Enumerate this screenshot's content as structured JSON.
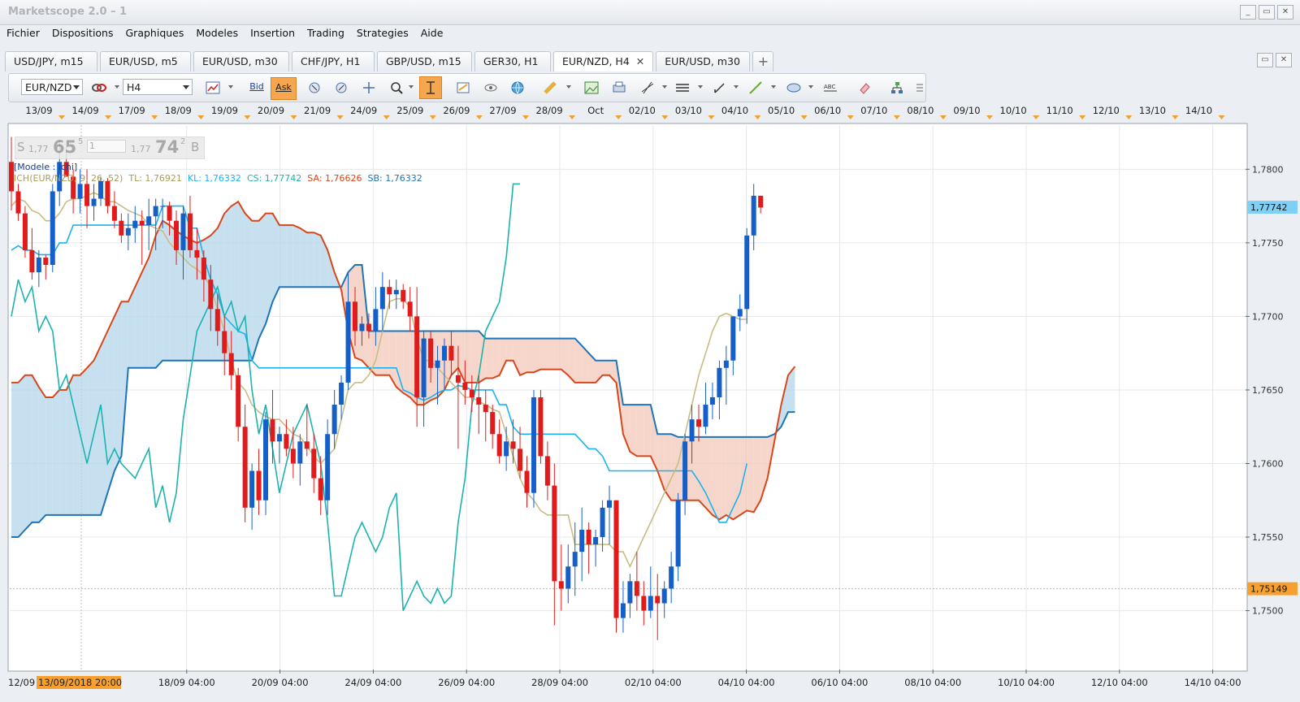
{
  "window": {
    "title": "Marketscope 2.0 – 1",
    "buttons": [
      "_",
      "▭",
      "✕"
    ]
  },
  "menu": [
    "Fichier",
    "Dispositions",
    "Graphiques",
    "Modeles",
    "Insertion",
    "Trading",
    "Strategies",
    "Aide"
  ],
  "tabs": [
    {
      "label": "USD/JPY, m15"
    },
    {
      "label": "EUR/USD, m5"
    },
    {
      "label": "EUR/USD, m30"
    },
    {
      "label": "CHF/JPY, H1"
    },
    {
      "label": "GBP/USD, m15"
    },
    {
      "label": "GER30, H1"
    },
    {
      "label": "EUR/NZD, H4",
      "active": true
    },
    {
      "label": "EUR/USD, m30"
    }
  ],
  "toolbar": {
    "instrument": "EUR/NZD",
    "timeframe": "H4",
    "bid_label": "Bid",
    "ask_label": "Ask",
    "icons": [
      "instrument-link-icon",
      "chart-type-icon",
      "cursor-left-icon",
      "cursor-right-icon",
      "crosshair-icon",
      "zoom-icon",
      "tracking-icon",
      "template-icon",
      "eye-icon",
      "globe-icon",
      "ruler-icon",
      "image-icon",
      "print-icon",
      "line-tools-icon",
      "horizontal-lines-icon",
      "pen-icon",
      "trend-line-icon",
      "ellipse-icon",
      "text-icon",
      "eraser-icon",
      "hierarchy-icon",
      "menu-icon"
    ]
  },
  "quote": {
    "sell_label": "S",
    "sell_prefix": "1,77",
    "sell_big": "65",
    "sell_sup": "5",
    "amount": "1",
    "buy_prefix": "1,77",
    "buy_big": "74",
    "buy_sup": "2",
    "buy_label": "B"
  },
  "legend": {
    "model": "[Modele : ichi]",
    "ichimoku_name": "ICH(EUR/NZD, 9, 26, 52)",
    "tl": "TL: 1,76921",
    "kl": "KL: 1,76332",
    "cs": "CS: 1,77742",
    "sa": "SA: 1,76626",
    "sb": "SB: 1,76332"
  },
  "colors": {
    "bull": "#1460c8",
    "bear": "#e01b1b",
    "tenkan": "#c8bd84",
    "kijun": "#1ab3ef",
    "chikou": "#1bb3b0",
    "senkou_a": "#d8461a",
    "senkou_b": "#1e74b8",
    "cloud_bull": "#b4d6ea",
    "cloud_bear": "#f3c8b8"
  },
  "chart_data": {
    "type": "candlestick",
    "instrument": "EUR/NZD",
    "timeframe": "H4",
    "ylim": [
      1.746,
      1.783
    ],
    "y_ticks": [
      "1,7800",
      "1,7750",
      "1,7700",
      "1,7650",
      "1,7600",
      "1,7550",
      "1,7500"
    ],
    "top_dates": [
      "13/09",
      "14/09",
      "17/09",
      "18/09",
      "19/09",
      "20/09",
      "21/09",
      "24/09",
      "25/09",
      "26/09",
      "27/09",
      "28/09",
      "Oct",
      "02/10",
      "03/10",
      "04/10",
      "05/10",
      "06/10",
      "07/10",
      "08/10",
      "09/10",
      "10/10",
      "11/10",
      "12/10",
      "13/10",
      "14/10"
    ],
    "bottom_dates": [
      "12/09",
      "13/09/2018 20:00",
      "18/09 04:00",
      "20/09 04:00",
      "24/09 04:00",
      "26/09 04:00",
      "28/09 04:00",
      "02/10 04:00",
      "04/10 04:00",
      "06/10 04:00",
      "08/10 04:00",
      "10/10 04:00",
      "12/10 04:00",
      "14/10 04:00"
    ],
    "current_price": "1,77742",
    "crosshair_price": "1,75149",
    "candles": [
      [
        1.7805,
        1.7822,
        1.7772,
        1.7785
      ],
      [
        1.7785,
        1.779,
        1.7765,
        1.777
      ],
      [
        1.777,
        1.7775,
        1.774,
        1.7745
      ],
      [
        1.7745,
        1.776,
        1.7725,
        1.773
      ],
      [
        1.773,
        1.7745,
        1.772,
        1.774
      ],
      [
        1.774,
        1.7742,
        1.7725,
        1.7735
      ],
      [
        1.7735,
        1.779,
        1.773,
        1.7785
      ],
      [
        1.7785,
        1.782,
        1.7775,
        1.7805
      ],
      [
        1.7805,
        1.7815,
        1.7795,
        1.7795
      ],
      [
        1.7795,
        1.78,
        1.777,
        1.778
      ],
      [
        1.778,
        1.78,
        1.777,
        1.779
      ],
      [
        1.779,
        1.78,
        1.776,
        1.7775
      ],
      [
        1.7775,
        1.779,
        1.7765,
        1.778
      ],
      [
        1.778,
        1.7795,
        1.7775,
        1.7792
      ],
      [
        1.7792,
        1.7794,
        1.777,
        1.7775
      ],
      [
        1.7775,
        1.7785,
        1.776,
        1.7765
      ],
      [
        1.7765,
        1.777,
        1.775,
        1.7755
      ],
      [
        1.7755,
        1.777,
        1.7745,
        1.776
      ],
      [
        1.776,
        1.7775,
        1.775,
        1.7765
      ],
      [
        1.7765,
        1.7772,
        1.7735,
        1.7762
      ],
      [
        1.7762,
        1.778,
        1.7745,
        1.7768
      ],
      [
        1.7768,
        1.778,
        1.7745,
        1.7775
      ],
      [
        1.7775,
        1.778,
        1.776,
        1.7775
      ],
      [
        1.7775,
        1.7778,
        1.7755,
        1.7765
      ],
      [
        1.7765,
        1.7772,
        1.7735,
        1.7745
      ],
      [
        1.7745,
        1.7775,
        1.7725,
        1.777
      ],
      [
        1.777,
        1.7782,
        1.774,
        1.7745
      ],
      [
        1.7745,
        1.776,
        1.7725,
        1.774
      ],
      [
        1.774,
        1.7745,
        1.771,
        1.7725
      ],
      [
        1.7725,
        1.7735,
        1.769,
        1.7705
      ],
      [
        1.7705,
        1.7715,
        1.768,
        1.769
      ],
      [
        1.769,
        1.77,
        1.766,
        1.7675
      ],
      [
        1.7675,
        1.769,
        1.765,
        1.766
      ],
      [
        1.766,
        1.7665,
        1.7615,
        1.7625
      ],
      [
        1.7625,
        1.764,
        1.756,
        1.757
      ],
      [
        1.757,
        1.76,
        1.7555,
        1.7595
      ],
      [
        1.7595,
        1.761,
        1.7565,
        1.7575
      ],
      [
        1.7575,
        1.7635,
        1.7565,
        1.763
      ],
      [
        1.763,
        1.765,
        1.76,
        1.7615
      ],
      [
        1.7615,
        1.7625,
        1.76,
        1.762
      ],
      [
        1.762,
        1.763,
        1.7605,
        1.761
      ],
      [
        1.761,
        1.7625,
        1.759,
        1.76
      ],
      [
        1.76,
        1.762,
        1.7585,
        1.7615
      ],
      [
        1.7615,
        1.764,
        1.7605,
        1.761
      ],
      [
        1.761,
        1.762,
        1.758,
        1.759
      ],
      [
        1.759,
        1.7605,
        1.7565,
        1.7575
      ],
      [
        1.7575,
        1.763,
        1.7565,
        1.762
      ],
      [
        1.762,
        1.765,
        1.761,
        1.764
      ],
      [
        1.764,
        1.766,
        1.763,
        1.7655
      ],
      [
        1.7655,
        1.773,
        1.765,
        1.771
      ],
      [
        1.771,
        1.772,
        1.768,
        1.769
      ],
      [
        1.769,
        1.77,
        1.768,
        1.7695
      ],
      [
        1.7695,
        1.7702,
        1.7685,
        1.769
      ],
      [
        1.769,
        1.772,
        1.768,
        1.7705
      ],
      [
        1.7705,
        1.773,
        1.769,
        1.772
      ],
      [
        1.772,
        1.7725,
        1.7705,
        1.7715
      ],
      [
        1.7715,
        1.7725,
        1.7705,
        1.7718
      ],
      [
        1.7718,
        1.7722,
        1.7705,
        1.771
      ],
      [
        1.771,
        1.772,
        1.769,
        1.77
      ],
      [
        1.77,
        1.772,
        1.7625,
        1.7645
      ],
      [
        1.7645,
        1.769,
        1.7625,
        1.7685
      ],
      [
        1.7685,
        1.769,
        1.7655,
        1.7665
      ],
      [
        1.7665,
        1.768,
        1.764,
        1.767
      ],
      [
        1.767,
        1.7685,
        1.765,
        1.768
      ],
      [
        1.768,
        1.769,
        1.766,
        1.767
      ],
      [
        1.766,
        1.768,
        1.761,
        1.7655
      ],
      [
        1.7655,
        1.767,
        1.764,
        1.765
      ],
      [
        1.765,
        1.766,
        1.7635,
        1.7645
      ],
      [
        1.7645,
        1.766,
        1.762,
        1.764
      ],
      [
        1.764,
        1.765,
        1.7615,
        1.7635
      ],
      [
        1.7635,
        1.764,
        1.761,
        1.762
      ],
      [
        1.762,
        1.763,
        1.76,
        1.7605
      ],
      [
        1.7605,
        1.7625,
        1.7595,
        1.7615
      ],
      [
        1.7615,
        1.763,
        1.76,
        1.761
      ],
      [
        1.761,
        1.7625,
        1.759,
        1.7595
      ],
      [
        1.7595,
        1.7605,
        1.757,
        1.758
      ],
      [
        1.758,
        1.765,
        1.757,
        1.7645
      ],
      [
        1.7645,
        1.765,
        1.76,
        1.7605
      ],
      [
        1.7605,
        1.7615,
        1.7575,
        1.7585
      ],
      [
        1.7585,
        1.76,
        1.749,
        1.752
      ],
      [
        1.752,
        1.7545,
        1.75,
        1.7515
      ],
      [
        1.7515,
        1.7545,
        1.7505,
        1.753
      ],
      [
        1.753,
        1.756,
        1.751,
        1.754
      ],
      [
        1.754,
        1.757,
        1.752,
        1.7555
      ],
      [
        1.7555,
        1.756,
        1.7525,
        1.7545
      ],
      [
        1.7545,
        1.7555,
        1.753,
        1.755
      ],
      [
        1.755,
        1.7575,
        1.754,
        1.757
      ],
      [
        1.757,
        1.7585,
        1.7545,
        1.7575
      ],
      [
        1.7575,
        1.7575,
        1.7485,
        1.7495
      ],
      [
        1.7495,
        1.752,
        1.7485,
        1.7505
      ],
      [
        1.7505,
        1.7525,
        1.7495,
        1.752
      ],
      [
        1.752,
        1.754,
        1.75,
        1.751
      ],
      [
        1.751,
        1.752,
        1.749,
        1.75
      ],
      [
        1.75,
        1.753,
        1.7495,
        1.751
      ],
      [
        1.751,
        1.7525,
        1.748,
        1.7505
      ],
      [
        1.7505,
        1.752,
        1.7495,
        1.7515
      ],
      [
        1.7515,
        1.754,
        1.7505,
        1.753
      ],
      [
        1.753,
        1.758,
        1.752,
        1.7575
      ],
      [
        1.7575,
        1.762,
        1.7565,
        1.7615
      ],
      [
        1.7615,
        1.764,
        1.76,
        1.763
      ],
      [
        1.763,
        1.764,
        1.7615,
        1.7625
      ],
      [
        1.7625,
        1.7655,
        1.762,
        1.764
      ],
      [
        1.764,
        1.7655,
        1.763,
        1.7645
      ],
      [
        1.7645,
        1.767,
        1.763,
        1.7665
      ],
      [
        1.7665,
        1.768,
        1.764,
        1.767
      ],
      [
        1.767,
        1.77,
        1.766,
        1.77
      ],
      [
        1.77,
        1.7715,
        1.769,
        1.7705
      ],
      [
        1.7705,
        1.776,
        1.7695,
        1.7755
      ],
      [
        1.7755,
        1.779,
        1.7745,
        1.7782
      ],
      [
        1.7782,
        1.7782,
        1.777,
        1.7774
      ]
    ],
    "tenkan": [
      1.7775,
      1.778,
      1.7778,
      1.7772,
      1.777,
      1.7765,
      1.7765,
      1.777,
      1.7778,
      1.778,
      1.778,
      1.7782,
      1.7784,
      1.7782,
      1.7778,
      1.7778,
      1.7775,
      1.7772,
      1.777,
      1.7768,
      1.7762,
      1.776,
      1.7758,
      1.775,
      1.7745,
      1.774,
      1.7735,
      1.7732,
      1.7728,
      1.772,
      1.7705,
      1.769,
      1.767,
      1.7655,
      1.765,
      1.764,
      1.7635,
      1.7632,
      1.763,
      1.763,
      1.7625,
      1.762,
      1.7618,
      1.7612,
      1.7605,
      1.76,
      1.7605,
      1.761,
      1.763,
      1.765,
      1.7655,
      1.7655,
      1.766,
      1.767,
      1.769,
      1.771,
      1.7712,
      1.7712,
      1.7706,
      1.7685,
      1.767,
      1.767,
      1.7665,
      1.766,
      1.7655,
      1.765,
      1.7645,
      1.7645,
      1.7642,
      1.764,
      1.7637,
      1.7635,
      1.762,
      1.7605,
      1.759,
      1.758,
      1.7575,
      1.7568,
      1.7565,
      1.7565,
      1.7565,
      1.7565,
      1.7545,
      1.7545,
      1.7545,
      1.7545,
      1.7545,
      1.7545,
      1.754,
      1.754,
      1.753,
      1.754,
      1.755,
      1.756,
      1.757,
      1.758,
      1.759,
      1.76,
      1.762,
      1.764,
      1.766,
      1.7675,
      1.769,
      1.77,
      1.7702,
      1.77,
      1.7698,
      1.7698
    ],
    "kijun": [
      1.7745,
      1.7748,
      1.7745,
      1.7745,
      1.7742,
      1.7742,
      1.7742,
      1.775,
      1.775,
      1.7762,
      1.7762,
      1.7762,
      1.7762,
      1.7762,
      1.7762,
      1.7762,
      1.7762,
      1.7762,
      1.7762,
      1.7762,
      1.7762,
      1.7762,
      1.7775,
      1.7775,
      1.7775,
      1.7775,
      1.776,
      1.776,
      1.774,
      1.7725,
      1.7715,
      1.77,
      1.7695,
      1.769,
      1.7688,
      1.767,
      1.7665,
      1.7665,
      1.7665,
      1.7665,
      1.7665,
      1.7665,
      1.7665,
      1.7665,
      1.7665,
      1.7665,
      1.7665,
      1.7665,
      1.7665,
      1.7665,
      1.7665,
      1.7665,
      1.7665,
      1.7665,
      1.7665,
      1.7665,
      1.7665,
      1.765,
      1.7648,
      1.7645,
      1.7643,
      1.7645,
      1.7648,
      1.765,
      1.765,
      1.7653,
      1.7652,
      1.765,
      1.765,
      1.765,
      1.765,
      1.764,
      1.764,
      1.7625,
      1.762,
      1.762,
      1.762,
      1.762,
      1.762,
      1.762,
      1.762,
      1.762,
      1.762,
      1.7615,
      1.761,
      1.761,
      1.7605,
      1.7595,
      1.7595,
      1.7595,
      1.7595,
      1.7595,
      1.7595,
      1.7595,
      1.7595,
      1.7595,
      1.7595,
      1.7595,
      1.7595,
      1.7595,
      1.7588,
      1.758,
      1.757,
      1.756,
      1.756,
      1.757,
      1.758,
      1.76
    ],
    "chikou": [
      1.77,
      1.7725,
      1.771,
      1.772,
      1.769,
      1.77,
      1.769,
      1.765,
      1.766,
      1.764,
      1.762,
      1.76,
      1.762,
      1.764,
      1.76,
      1.761,
      1.76,
      1.7595,
      1.759,
      1.76,
      1.761,
      1.757,
      1.7585,
      1.756,
      1.758,
      1.763,
      1.766,
      1.769,
      1.77,
      1.771,
      1.772,
      1.77,
      1.771,
      1.769,
      1.77,
      1.765,
      1.762,
      1.764,
      1.761,
      1.758,
      1.76,
      1.762,
      1.763,
      1.764,
      1.762,
      1.76,
      1.756,
      1.751,
      1.751,
      1.753,
      1.755,
      1.756,
      1.755,
      1.754,
      1.755,
      1.757,
      1.758,
      1.75,
      1.751,
      1.752,
      1.751,
      1.7505,
      1.7515,
      1.7505,
      1.751,
      1.756,
      1.759,
      1.764,
      1.766,
      1.769,
      1.77,
      1.771,
      1.774,
      1.779,
      1.779
    ],
    "cloud_start_index": 0,
    "senkou_a": [
      1.7655,
      1.7655,
      1.766,
      1.766,
      1.7652,
      1.7645,
      1.7645,
      1.765,
      1.765,
      1.766,
      1.766,
      1.7665,
      1.767,
      1.768,
      1.769,
      1.77,
      1.771,
      1.771,
      1.772,
      1.773,
      1.774,
      1.7755,
      1.7765,
      1.7762,
      1.7758,
      1.7755,
      1.7752,
      1.775,
      1.7752,
      1.7755,
      1.776,
      1.777,
      1.7775,
      1.7778,
      1.777,
      1.7765,
      1.7765,
      1.777,
      1.777,
      1.7762,
      1.7762,
      1.7762,
      1.776,
      1.7757,
      1.7757,
      1.7755,
      1.7745,
      1.773,
      1.7718,
      1.769,
      1.7672,
      1.767,
      1.7665,
      1.766,
      1.766,
      1.766,
      1.7652,
      1.7648,
      1.7645,
      1.764,
      1.764,
      1.7643,
      1.7645,
      1.765,
      1.766,
      1.7665,
      1.7655,
      1.7655,
      1.7655,
      1.7658,
      1.7658,
      1.766,
      1.767,
      1.767,
      1.766,
      1.7662,
      1.7662,
      1.7664,
      1.7664,
      1.7664,
      1.7664,
      1.766,
      1.7655,
      1.7655,
      1.7655,
      1.7655,
      1.766,
      1.766,
      1.7655,
      1.762,
      1.7608,
      1.7605,
      1.7605,
      1.7605,
      1.7595,
      1.7582,
      1.7575,
      1.7575,
      1.7575,
      1.7575,
      1.7575,
      1.757,
      1.7565,
      1.7562,
      1.7565,
      1.7562,
      1.7565,
      1.7568,
      1.7567,
      1.7575,
      1.759,
      1.7615,
      1.764,
      1.766,
      1.7666
    ],
    "senkou_b": [
      1.755,
      1.755,
      1.7555,
      1.756,
      1.756,
      1.7565,
      1.7565,
      1.7565,
      1.7565,
      1.7565,
      1.7565,
      1.7565,
      1.7565,
      1.7565,
      1.758,
      1.7595,
      1.7605,
      1.7665,
      1.7665,
      1.7665,
      1.7665,
      1.7665,
      1.767,
      1.767,
      1.767,
      1.767,
      1.767,
      1.767,
      1.767,
      1.767,
      1.767,
      1.767,
      1.767,
      1.767,
      1.767,
      1.767,
      1.7685,
      1.7695,
      1.771,
      1.772,
      1.772,
      1.772,
      1.772,
      1.772,
      1.772,
      1.772,
      1.772,
      1.772,
      1.772,
      1.773,
      1.7735,
      1.7735,
      1.769,
      1.769,
      1.769,
      1.769,
      1.769,
      1.769,
      1.769,
      1.769,
      1.769,
      1.769,
      1.769,
      1.769,
      1.769,
      1.769,
      1.769,
      1.769,
      1.769,
      1.7685,
      1.7685,
      1.7685,
      1.7685,
      1.7685,
      1.7685,
      1.7685,
      1.7685,
      1.7685,
      1.7685,
      1.7685,
      1.7685,
      1.7685,
      1.7685,
      1.768,
      1.7675,
      1.767,
      1.767,
      1.767,
      1.767,
      1.764,
      1.764,
      1.764,
      1.764,
      1.764,
      1.762,
      1.762,
      1.762,
      1.7618,
      1.7618,
      1.7618,
      1.7618,
      1.7618,
      1.7618,
      1.7618,
      1.7618,
      1.7618,
      1.7618,
      1.7618,
      1.7618,
      1.7618,
      1.7618,
      1.762,
      1.7625,
      1.7635,
      1.7635
    ]
  }
}
